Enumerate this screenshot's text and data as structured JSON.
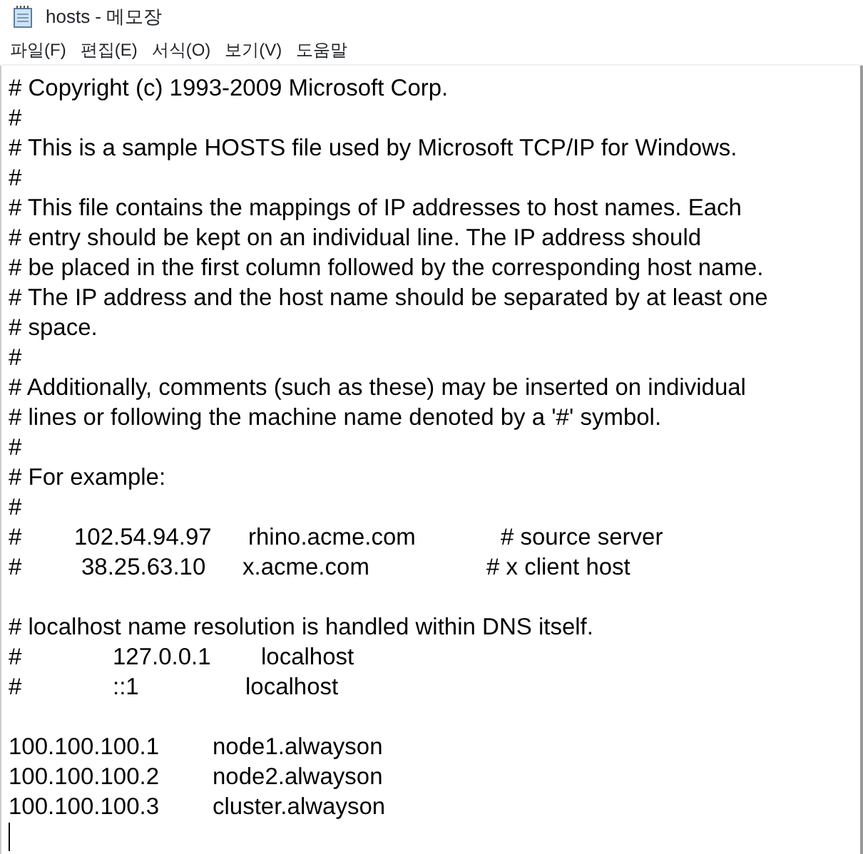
{
  "window": {
    "title": "hosts - 메모장"
  },
  "menu": [
    "파일(F)",
    "편집(E)",
    "서식(O)",
    "보기(V)",
    "도움말"
  ],
  "lines": [
    {
      "kind": "text",
      "cells": [
        "# Copyright (c) 1993-2009 Microsoft Corp."
      ]
    },
    {
      "kind": "text",
      "cells": [
        "#"
      ]
    },
    {
      "kind": "text",
      "cells": [
        "# This is a sample HOSTS file used by Microsoft TCP/IP for Windows."
      ]
    },
    {
      "kind": "text",
      "cells": [
        "#"
      ]
    },
    {
      "kind": "text",
      "cells": [
        "# This file contains the mappings of IP addresses to host names. Each"
      ]
    },
    {
      "kind": "text",
      "cells": [
        "# entry should be kept on an individual line. The IP address should"
      ]
    },
    {
      "kind": "text",
      "cells": [
        "# be placed in the first column followed by the corresponding host name."
      ]
    },
    {
      "kind": "text",
      "cells": [
        "# The IP address and the host name should be separated by at least one"
      ]
    },
    {
      "kind": "text",
      "cells": [
        "# space."
      ]
    },
    {
      "kind": "text",
      "cells": [
        "#"
      ]
    },
    {
      "kind": "text",
      "cells": [
        "# Additionally, comments (such as these) may be inserted on individual"
      ]
    },
    {
      "kind": "text",
      "cells": [
        "# lines or following the machine name denoted by a '#' symbol."
      ]
    },
    {
      "kind": "text",
      "cells": [
        "#"
      ]
    },
    {
      "kind": "text",
      "cells": [
        "# For example:"
      ]
    },
    {
      "kind": "text",
      "cells": [
        "#"
      ]
    },
    {
      "kind": "example",
      "cells": [
        "#",
        "102.54.94.97",
        "rhino.acme.com",
        "# source server"
      ]
    },
    {
      "kind": "example2",
      "cells": [
        "#",
        "38.25.63.10",
        "x.acme.com",
        "# x client host"
      ]
    },
    {
      "kind": "blank"
    },
    {
      "kind": "text",
      "cells": [
        "# localhost name resolution is handled within DNS itself."
      ]
    },
    {
      "kind": "local",
      "cells": [
        "#",
        "127.0.0.1",
        "localhost"
      ]
    },
    {
      "kind": "local2",
      "cells": [
        "#",
        "::1",
        "localhost"
      ]
    },
    {
      "kind": "blank"
    },
    {
      "kind": "entry",
      "cells": [
        "100.100.100.1",
        "node1.alwayson"
      ]
    },
    {
      "kind": "entry",
      "cells": [
        "100.100.100.2",
        "node2.alwayson"
      ]
    },
    {
      "kind": "entry",
      "cells": [
        "100.100.100.3",
        "cluster.alwayson"
      ]
    }
  ]
}
